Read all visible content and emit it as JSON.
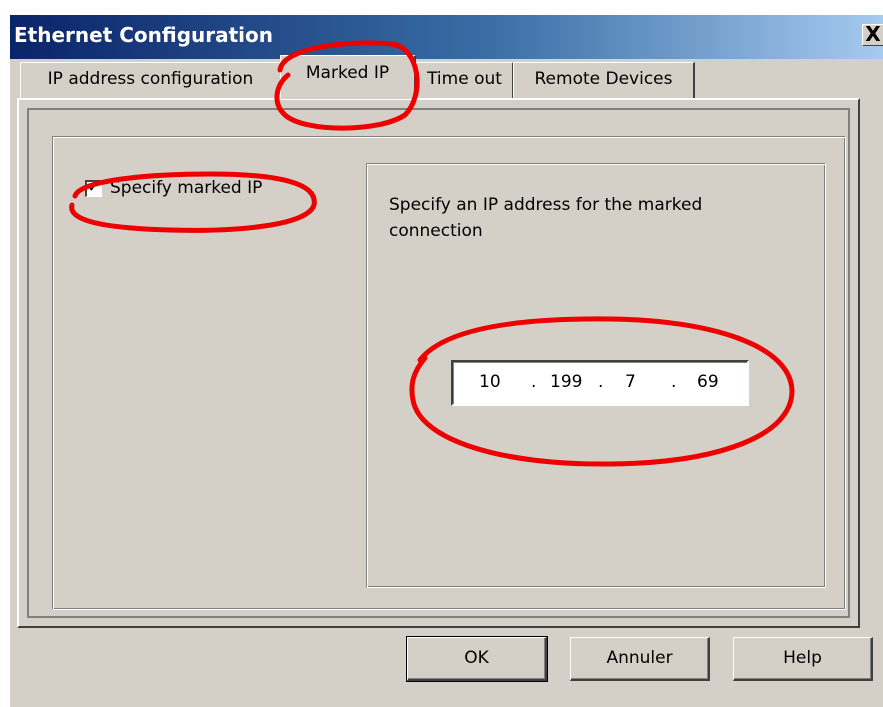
{
  "window": {
    "title": "Ethernet Configuration",
    "close_label": "X"
  },
  "tabs": [
    {
      "label": "IP address configuration",
      "active": false
    },
    {
      "label": "Marked IP",
      "active": true
    },
    {
      "label": "Time out",
      "active": false
    },
    {
      "label": "Remote Devices",
      "active": false
    }
  ],
  "marked_ip": {
    "checkbox_label": "Specify marked IP",
    "checked": true,
    "description": "Specify an IP address for the marked connection",
    "ip": {
      "octet1": "10",
      "octet2": "199",
      "octet3": "7",
      "octet4": "69",
      "separator": "."
    }
  },
  "buttons": {
    "ok": "OK",
    "cancel": "Annuler",
    "help": "Help"
  },
  "colors": {
    "annotation": "#ee0000",
    "dialog_face": "#d4d0c8",
    "title_gradient_start": "#0a246a",
    "title_gradient_end": "#a6caf0"
  }
}
